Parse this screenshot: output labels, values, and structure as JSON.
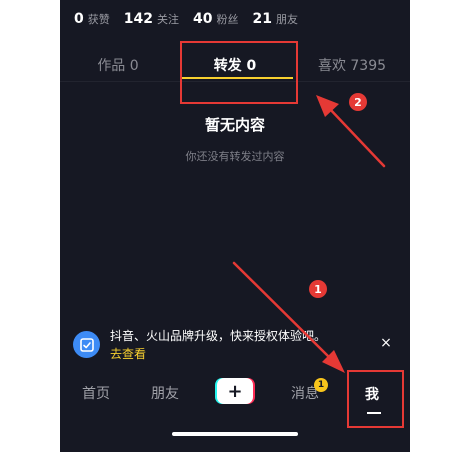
{
  "stats": [
    {
      "num": "0",
      "label": "获赞"
    },
    {
      "num": "142",
      "label": "关注"
    },
    {
      "num": "40",
      "label": "粉丝"
    },
    {
      "num": "21",
      "label": "朋友"
    }
  ],
  "tabs": [
    {
      "label": "作品 0",
      "active": false
    },
    {
      "label": "转发 0",
      "active": true
    },
    {
      "label": "喜欢 7395",
      "active": false
    }
  ],
  "empty_state": {
    "title": "暂无内容",
    "subtitle": "你还没有转发过内容"
  },
  "banner": {
    "icon": "authorize-icon",
    "text": "抖音、火山品牌升级，快来授权体验吧。",
    "link": "去查看",
    "close": "×"
  },
  "nav": {
    "home": "首页",
    "friends": "朋友",
    "plus": "+",
    "messages": "消息",
    "messages_badge": "1",
    "me": "我"
  },
  "annotations": {
    "marker1": "1",
    "marker2": "2",
    "color": "#e53935"
  },
  "colors": {
    "background": "#161823",
    "accent": "#f8d02f"
  }
}
